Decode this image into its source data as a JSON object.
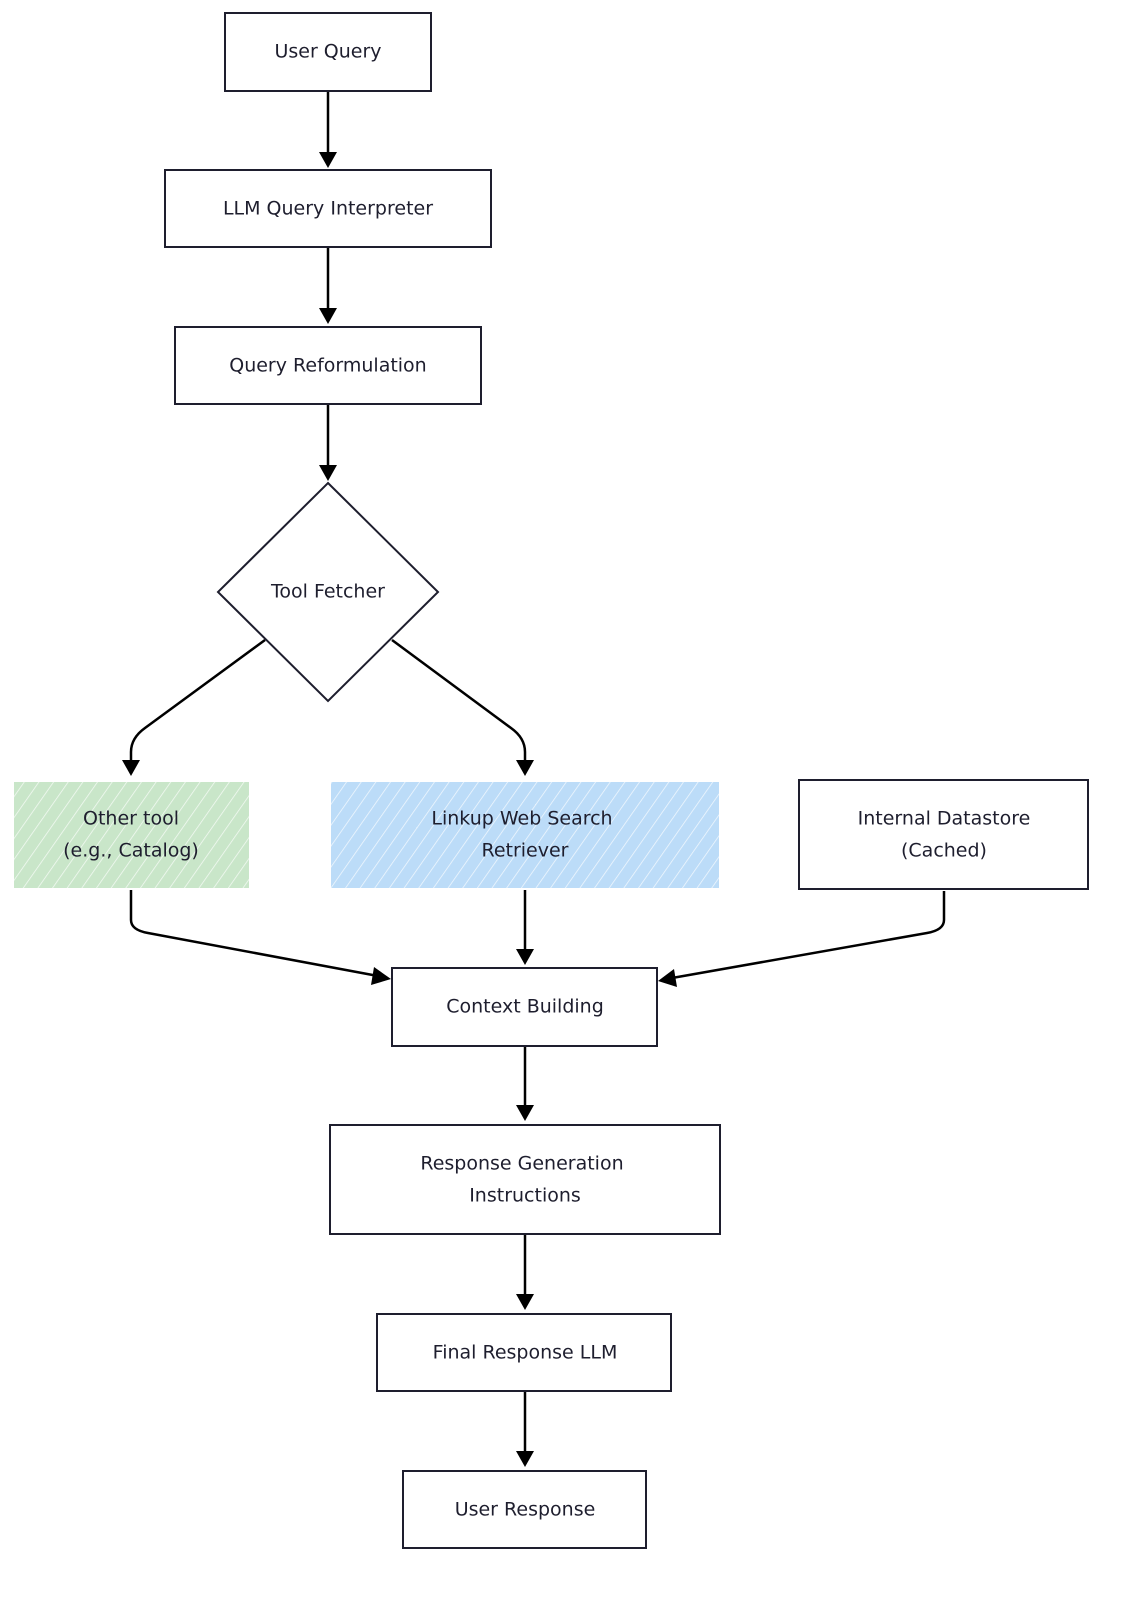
{
  "colors": {
    "other_tool_fill": "#c9e6c9",
    "linkup_fill": "#bcdcf8",
    "stroke": "#1e1e2e"
  },
  "nodes": {
    "user_query": {
      "lines": [
        "User Query"
      ]
    },
    "llm_interpreter": {
      "lines": [
        "LLM Query Interpreter"
      ]
    },
    "reformulation": {
      "lines": [
        "Query Reformulation"
      ]
    },
    "tool_fetcher": {
      "lines": [
        "Tool Fetcher"
      ],
      "shape": "diamond"
    },
    "other_tool": {
      "lines": [
        "Other tool",
        "(e.g., Catalog)"
      ]
    },
    "linkup": {
      "lines": [
        "Linkup Web Search",
        "Retriever"
      ]
    },
    "internal": {
      "lines": [
        "Internal Datastore",
        "(Cached)"
      ]
    },
    "context": {
      "lines": [
        "Context Building"
      ]
    },
    "response_gen": {
      "lines": [
        "Response Generation",
        "Instructions"
      ]
    },
    "final_llm": {
      "lines": [
        "Final Response LLM"
      ]
    },
    "user_response": {
      "lines": [
        "User Response"
      ]
    }
  },
  "edges": [
    [
      "user_query",
      "llm_interpreter"
    ],
    [
      "llm_interpreter",
      "reformulation"
    ],
    [
      "reformulation",
      "tool_fetcher"
    ],
    [
      "tool_fetcher",
      "other_tool"
    ],
    [
      "tool_fetcher",
      "linkup"
    ],
    [
      "other_tool",
      "context"
    ],
    [
      "linkup",
      "context"
    ],
    [
      "internal",
      "context"
    ],
    [
      "context",
      "response_gen"
    ],
    [
      "response_gen",
      "final_llm"
    ],
    [
      "final_llm",
      "user_response"
    ]
  ]
}
